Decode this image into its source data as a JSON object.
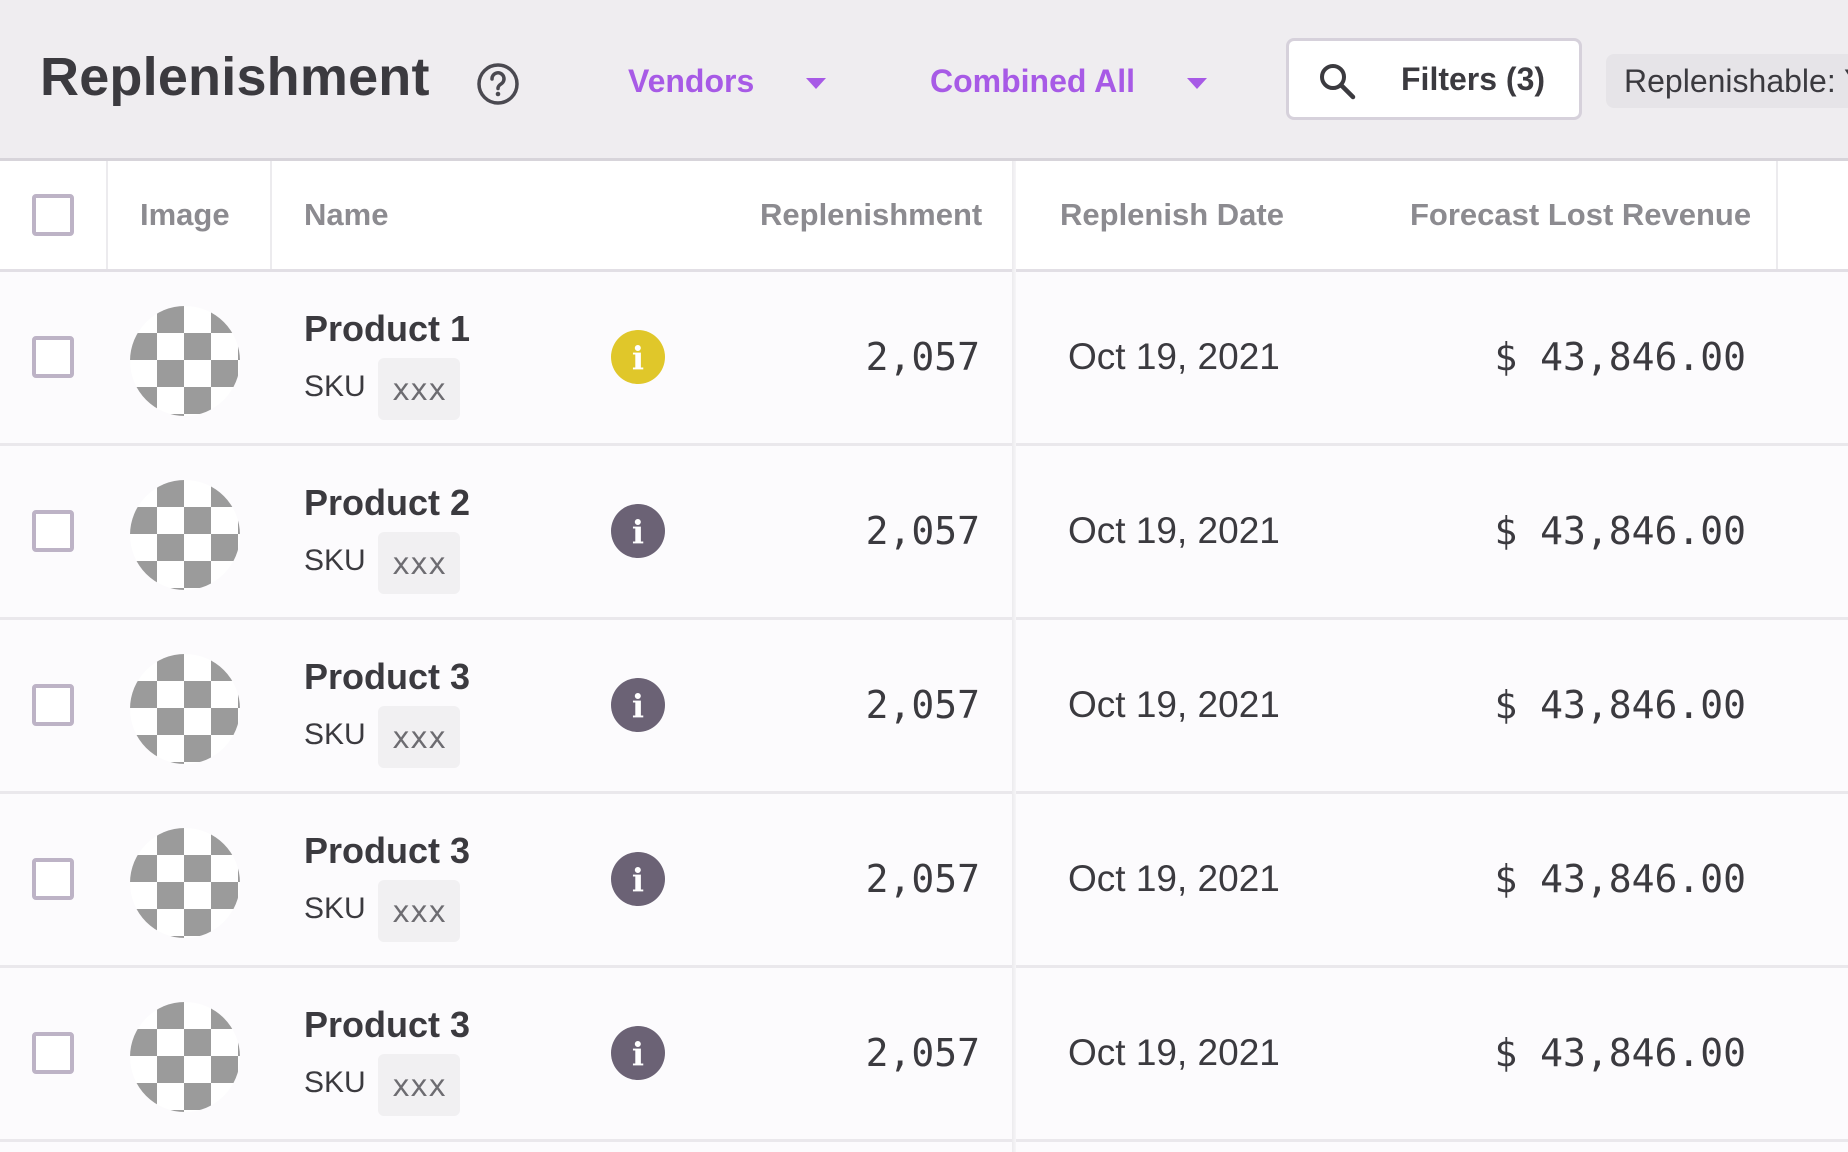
{
  "header": {
    "title": "Replenishment",
    "vendors_label": "Vendors",
    "combined_label": "Combined All",
    "filters_label": "Filters (3)",
    "chip_label": "Replenishable: Y"
  },
  "table": {
    "columns": {
      "image": "Image",
      "name": "Name",
      "replenishment": "Replenishment",
      "replenish_date": "Replenish Date",
      "forecast_lost_revenue": "Forecast Lost Revenue"
    },
    "sku_label": "SKU",
    "rows": [
      {
        "name": "Product 1",
        "sku": "xxx",
        "status": "warning",
        "replenishment": "2,057",
        "date": "Oct 19, 2021",
        "revenue": "$ 43,846.00"
      },
      {
        "name": "Product 2",
        "sku": "xxx",
        "status": "neutral",
        "replenishment": "2,057",
        "date": "Oct 19, 2021",
        "revenue": "$ 43,846.00"
      },
      {
        "name": "Product 3",
        "sku": "xxx",
        "status": "neutral",
        "replenishment": "2,057",
        "date": "Oct 19, 2021",
        "revenue": "$ 43,846.00"
      },
      {
        "name": "Product 3",
        "sku": "xxx",
        "status": "neutral",
        "replenishment": "2,057",
        "date": "Oct 19, 2021",
        "revenue": "$ 43,846.00"
      },
      {
        "name": "Product 3",
        "sku": "xxx",
        "status": "neutral",
        "replenishment": "2,057",
        "date": "Oct 19, 2021",
        "revenue": "$ 43,846.00"
      }
    ]
  },
  "colors": {
    "accent": "#a75ae6",
    "info_warning": "#e0c72a",
    "info_neutral": "#6b6275"
  },
  "icons": {
    "help": "help-circle-icon",
    "dropdown": "caret-down-icon",
    "search": "search-icon",
    "info": "info-icon",
    "thumbnail": "image-placeholder-icon"
  }
}
